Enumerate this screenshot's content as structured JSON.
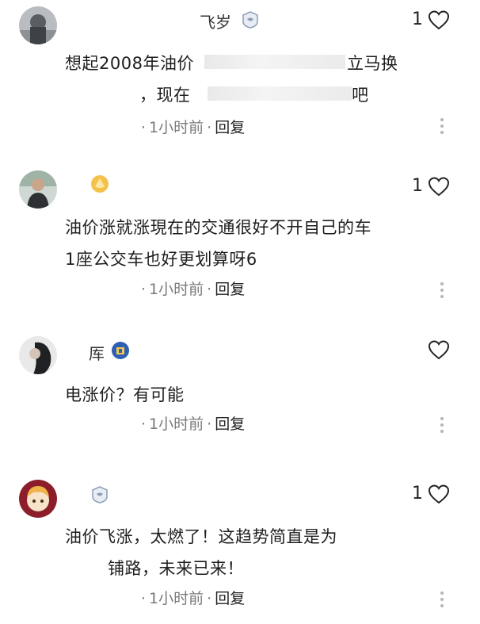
{
  "comments": [
    {
      "username": "飞岁",
      "likes": "1",
      "lines": [
        "想起2008年油价",
        "立马换",
        "，现在",
        "吧"
      ],
      "time": "1小时前",
      "reply_label": "回复",
      "badge_icon": "level-badge-icon",
      "avatar_icon": "user-avatar"
    },
    {
      "username": "",
      "likes": "1",
      "lines": [
        "油价涨就涨現在的交通很好不开自己的车",
        "1座公交车也好更划算呀6"
      ],
      "time": "1小时前",
      "reply_label": "回复",
      "badge_icon": "gold-badge-icon",
      "avatar_icon": "user-avatar"
    },
    {
      "username": "厍",
      "likes": "",
      "lines": [
        "电涨价？有可能"
      ],
      "time": "1小时前",
      "reply_label": "回复",
      "badge_icon": "shield-badge-icon",
      "avatar_icon": "user-avatar"
    },
    {
      "username": "",
      "likes": "1",
      "lines": [
        "油价飞涨，太燃了！这趋势简直是为",
        "铺路，未来已来！"
      ],
      "time": "1小时前",
      "reply_label": "回复",
      "badge_icon": "level-badge-icon",
      "avatar_icon": "user-avatar"
    }
  ],
  "colors": {
    "text": "#1e1e1e",
    "meta": "#7a7a7a",
    "background": "#ffffff"
  }
}
